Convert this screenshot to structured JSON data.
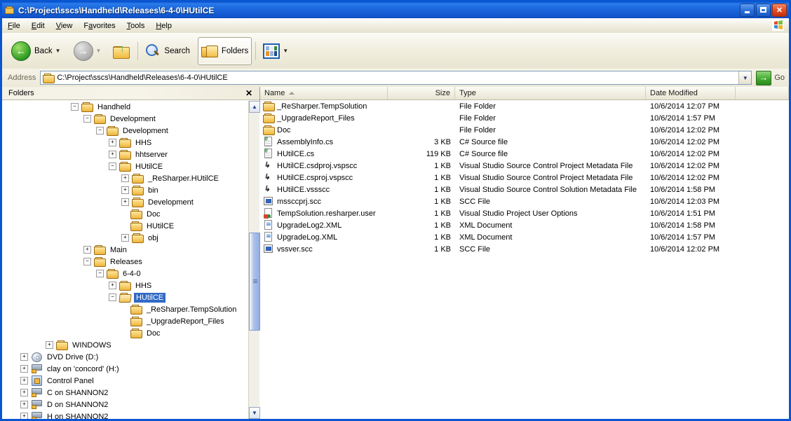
{
  "window": {
    "title": "C:\\Project\\sscs\\Handheld\\Releases\\6-4-0\\HUtilCE",
    "icon": "folder-icon",
    "minimize_label": "Minimize",
    "maximize_label": "Maximize",
    "close_label": "Close"
  },
  "menubar": {
    "items": [
      {
        "label": "File",
        "accel": "F"
      },
      {
        "label": "Edit",
        "accel": "E"
      },
      {
        "label": "View",
        "accel": "V"
      },
      {
        "label": "Favorites",
        "accel": "a"
      },
      {
        "label": "Tools",
        "accel": "T"
      },
      {
        "label": "Help",
        "accel": "H"
      }
    ]
  },
  "toolbar": {
    "back_label": "Back",
    "forward_label": "",
    "up_label": "",
    "search_label": "Search",
    "folders_label": "Folders",
    "views_label": ""
  },
  "address": {
    "label": "Address",
    "value": "C:\\Project\\sscs\\Handheld\\Releases\\6-4-0\\HUtilCE",
    "go_label": "Go"
  },
  "folders_pane": {
    "title": "Folders",
    "close_label": "✕",
    "tree": [
      {
        "label": "Handheld",
        "indent": 5,
        "toggle": "minus",
        "icon": "folder-icon",
        "selected": false
      },
      {
        "label": "Development",
        "indent": 6,
        "toggle": "minus",
        "icon": "folder-icon",
        "selected": false
      },
      {
        "label": "Development",
        "indent": 7,
        "toggle": "minus",
        "icon": "folder-icon",
        "selected": false
      },
      {
        "label": "HHS",
        "indent": 8,
        "toggle": "plus",
        "icon": "folder-icon",
        "selected": false
      },
      {
        "label": "hhtserver",
        "indent": 8,
        "toggle": "plus",
        "icon": "folder-icon",
        "selected": false
      },
      {
        "label": "HUtilCE",
        "indent": 8,
        "toggle": "minus",
        "icon": "folder-icon",
        "selected": false
      },
      {
        "label": "_ReSharper.HUtilCE",
        "indent": 9,
        "toggle": "plus",
        "icon": "folder-icon",
        "selected": false
      },
      {
        "label": "bin",
        "indent": 9,
        "toggle": "plus",
        "icon": "folder-icon",
        "selected": false
      },
      {
        "label": "Development",
        "indent": 9,
        "toggle": "plus",
        "icon": "folder-icon",
        "selected": false
      },
      {
        "label": "Doc",
        "indent": 9,
        "toggle": "none",
        "icon": "folder-icon",
        "selected": false
      },
      {
        "label": "HUtilCE",
        "indent": 9,
        "toggle": "none",
        "icon": "folder-icon",
        "selected": false
      },
      {
        "label": "obj",
        "indent": 9,
        "toggle": "plus",
        "icon": "folder-icon",
        "selected": false
      },
      {
        "label": "Main",
        "indent": 6,
        "toggle": "plus",
        "icon": "folder-icon",
        "selected": false
      },
      {
        "label": "Releases",
        "indent": 6,
        "toggle": "minus",
        "icon": "folder-icon",
        "selected": false
      },
      {
        "label": "6-4-0",
        "indent": 7,
        "toggle": "minus",
        "icon": "folder-icon",
        "selected": false
      },
      {
        "label": "HHS",
        "indent": 8,
        "toggle": "plus",
        "icon": "folder-icon",
        "selected": false
      },
      {
        "label": "HUtilCE",
        "indent": 8,
        "toggle": "minus",
        "icon": "folder-open-icon",
        "selected": true
      },
      {
        "label": "_ReSharper.TempSolution",
        "indent": 9,
        "toggle": "none",
        "icon": "folder-icon",
        "selected": false
      },
      {
        "label": "_UpgradeReport_Files",
        "indent": 9,
        "toggle": "none",
        "icon": "folder-icon",
        "selected": false
      },
      {
        "label": "Doc",
        "indent": 9,
        "toggle": "none",
        "icon": "folder-icon",
        "selected": false
      },
      {
        "label": "WINDOWS",
        "indent": 3,
        "toggle": "plus",
        "icon": "folder-icon",
        "selected": false
      },
      {
        "label": "DVD Drive (D:)",
        "indent": 1,
        "toggle": "plus",
        "icon": "dvd-drive-icon",
        "selected": false
      },
      {
        "label": "clay on 'concord' (H:)",
        "indent": 1,
        "toggle": "plus",
        "icon": "network-drive-icon",
        "selected": false
      },
      {
        "label": "Control Panel",
        "indent": 1,
        "toggle": "plus",
        "icon": "control-panel-icon",
        "selected": false
      },
      {
        "label": "C on SHANNON2",
        "indent": 1,
        "toggle": "plus",
        "icon": "network-drive-icon",
        "selected": false
      },
      {
        "label": "D on SHANNON2",
        "indent": 1,
        "toggle": "plus",
        "icon": "network-drive-icon",
        "selected": false
      },
      {
        "label": "H on SHANNON2",
        "indent": 1,
        "toggle": "plus",
        "icon": "network-drive-icon",
        "selected": false
      }
    ]
  },
  "filelist": {
    "columns": [
      {
        "label": "Name",
        "sorted": true
      },
      {
        "label": "Size",
        "sorted": false
      },
      {
        "label": "Type",
        "sorted": false
      },
      {
        "label": "Date Modified",
        "sorted": false
      }
    ],
    "rows": [
      {
        "name": "_ReSharper.TempSolution",
        "size": "",
        "type": "File Folder",
        "date": "10/6/2014 12:07 PM",
        "icon": "folder-icon"
      },
      {
        "name": "_UpgradeReport_Files",
        "size": "",
        "type": "File Folder",
        "date": "10/6/2014 1:57 PM",
        "icon": "folder-icon"
      },
      {
        "name": "Doc",
        "size": "",
        "type": "File Folder",
        "date": "10/6/2014 12:02 PM",
        "icon": "folder-icon"
      },
      {
        "name": "AssemblyInfo.cs",
        "size": "3 KB",
        "type": "C# Source file",
        "date": "10/6/2014 12:02 PM",
        "icon": "csharp-source-icon"
      },
      {
        "name": "HUtilCE.cs",
        "size": "119 KB",
        "type": "C# Source file",
        "date": "10/6/2014 12:02 PM",
        "icon": "csharp-source-icon"
      },
      {
        "name": "HUtilCE.csdproj.vspscc",
        "size": "1 KB",
        "type": "Visual Studio Source Control Project Metadata File",
        "date": "10/6/2014 12:02 PM",
        "icon": "vspscc-icon"
      },
      {
        "name": "HUtilCE.csproj.vspscc",
        "size": "1 KB",
        "type": "Visual Studio Source Control Project Metadata File",
        "date": "10/6/2014 12:02 PM",
        "icon": "vspscc-icon"
      },
      {
        "name": "HUtilCE.vssscc",
        "size": "1 KB",
        "type": "Visual Studio Source Control Solution Metadata File",
        "date": "10/6/2014 1:58 PM",
        "icon": "vspscc-icon"
      },
      {
        "name": "mssccprj.scc",
        "size": "1 KB",
        "type": "SCC File",
        "date": "10/6/2014 12:03 PM",
        "icon": "scc-file-icon"
      },
      {
        "name": "TempSolution.resharper.user",
        "size": "1 KB",
        "type": "Visual Studio Project User Options",
        "date": "10/6/2014 1:51 PM",
        "icon": "vs-user-options-icon"
      },
      {
        "name": "UpgradeLog2.XML",
        "size": "1 KB",
        "type": "XML Document",
        "date": "10/6/2014 1:58 PM",
        "icon": "xml-document-icon"
      },
      {
        "name": "UpgradeLog.XML",
        "size": "1 KB",
        "type": "XML Document",
        "date": "10/6/2014 1:57 PM",
        "icon": "xml-document-icon"
      },
      {
        "name": "vssver.scc",
        "size": "1 KB",
        "type": "SCC File",
        "date": "10/6/2014 12:02 PM",
        "icon": "scc-file-icon"
      }
    ]
  },
  "colors": {
    "titlebar": "#1C68DE",
    "selection": "#316AC5",
    "chrome": "#ECE9D8",
    "folder": "#EEB63A"
  }
}
